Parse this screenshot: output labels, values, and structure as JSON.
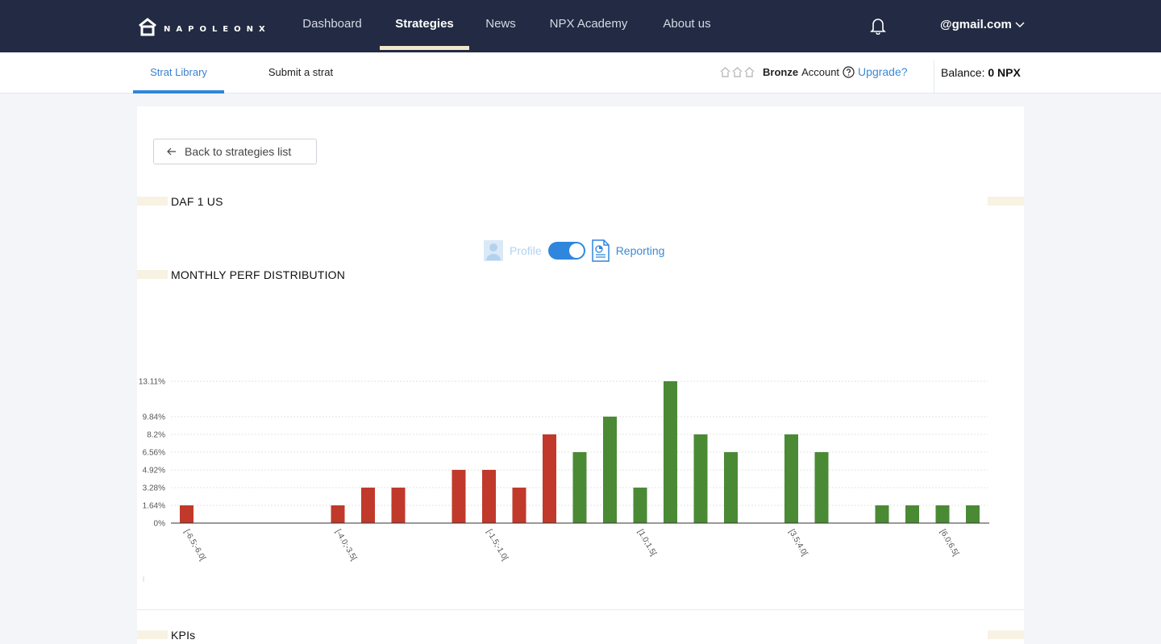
{
  "brand": {
    "name": "NAPOLEONX"
  },
  "nav": {
    "items": [
      {
        "label": "Dashboard",
        "active": false
      },
      {
        "label": "Strategies",
        "active": true
      },
      {
        "label": "News",
        "active": false
      },
      {
        "label": "NPX Academy",
        "active": false
      },
      {
        "label": "About us",
        "active": false
      }
    ],
    "user_email": "@gmail.com"
  },
  "subnav": {
    "tabs": [
      {
        "label": "Strat Library",
        "active": true
      },
      {
        "label": "Submit a strat",
        "active": false
      }
    ],
    "account_tier": "Bronze",
    "account_word": "Account",
    "upgrade_label": "Upgrade?",
    "balance_label": "Balance:",
    "balance_value": "0 NPX"
  },
  "content": {
    "back_label": "Back to strategies list",
    "strategy_name": "DAF 1 US",
    "toggle": {
      "left_label": "Profile",
      "right_label": "Reporting",
      "on": true
    },
    "section_title": "MONTHLY PERF DISTRIBUTION",
    "next_section_title": "KPIs"
  },
  "colors": {
    "navbar": "#222b43",
    "accent": "#2f86dd",
    "negative_bar": "#c0392b",
    "positive_bar": "#4a8a35",
    "section_marker": "#f8f2e3"
  },
  "chart_data": {
    "type": "bar",
    "title": "",
    "xlabel": "",
    "ylabel": "",
    "ylim": [
      0,
      13.11
    ],
    "yticks": [
      "0%",
      "1.64%",
      "3.28%",
      "4.92%",
      "6.56%",
      "8.2%",
      "9.84%",
      "13.11%"
    ],
    "ytick_values": [
      0,
      1.64,
      3.28,
      4.92,
      6.56,
      8.2,
      9.84,
      13.11
    ],
    "xtick_labels": [
      "[-6.5;-6.0[",
      "[-4.0;-3.5[",
      "[-1.5;-1.0[",
      "[1.0;1.5[",
      "[3.5;4.0[",
      "[6.0;6.5["
    ],
    "xtick_indices": [
      0,
      5,
      10,
      15,
      20,
      25
    ],
    "bins": [
      {
        "value": 1.64,
        "sign": "neg"
      },
      {
        "value": 0,
        "sign": "neg"
      },
      {
        "value": 0,
        "sign": "neg"
      },
      {
        "value": 0,
        "sign": "neg"
      },
      {
        "value": 0,
        "sign": "neg"
      },
      {
        "value": 1.64,
        "sign": "neg"
      },
      {
        "value": 3.28,
        "sign": "neg"
      },
      {
        "value": 3.28,
        "sign": "neg"
      },
      {
        "value": 0,
        "sign": "neg"
      },
      {
        "value": 4.92,
        "sign": "neg"
      },
      {
        "value": 4.92,
        "sign": "neg"
      },
      {
        "value": 3.28,
        "sign": "neg"
      },
      {
        "value": 8.2,
        "sign": "neg"
      },
      {
        "value": 6.56,
        "sign": "pos"
      },
      {
        "value": 9.84,
        "sign": "pos"
      },
      {
        "value": 3.28,
        "sign": "pos"
      },
      {
        "value": 13.11,
        "sign": "pos"
      },
      {
        "value": 8.2,
        "sign": "pos"
      },
      {
        "value": 6.56,
        "sign": "pos"
      },
      {
        "value": 0,
        "sign": "pos"
      },
      {
        "value": 8.2,
        "sign": "pos"
      },
      {
        "value": 6.56,
        "sign": "pos"
      },
      {
        "value": 0,
        "sign": "pos"
      },
      {
        "value": 1.64,
        "sign": "pos"
      },
      {
        "value": 1.64,
        "sign": "pos"
      },
      {
        "value": 1.64,
        "sign": "pos"
      },
      {
        "value": 1.64,
        "sign": "pos"
      }
    ]
  }
}
